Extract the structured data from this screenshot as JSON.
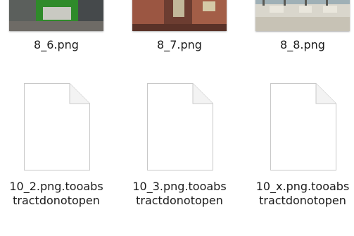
{
  "files": [
    {
      "name": "8_6.png",
      "icon": "image-thumbnail-icon"
    },
    {
      "name": "8_7.png",
      "icon": "image-thumbnail-icon"
    },
    {
      "name": "8_8.png",
      "icon": "image-thumbnail-icon"
    },
    {
      "name": "10_2.png.tooabs\ntractdonotopen",
      "icon": "generic-file-icon"
    },
    {
      "name": "10_3.png.tooabs\ntractdonotopen",
      "icon": "generic-file-icon"
    },
    {
      "name": "10_x.png.tooabs\ntractdonotopen",
      "icon": "generic-file-icon"
    }
  ],
  "colors": {
    "label_text": "#1b1b1b",
    "file_icon_fill": "#ffffff",
    "file_icon_stroke": "#c8c8c8"
  }
}
